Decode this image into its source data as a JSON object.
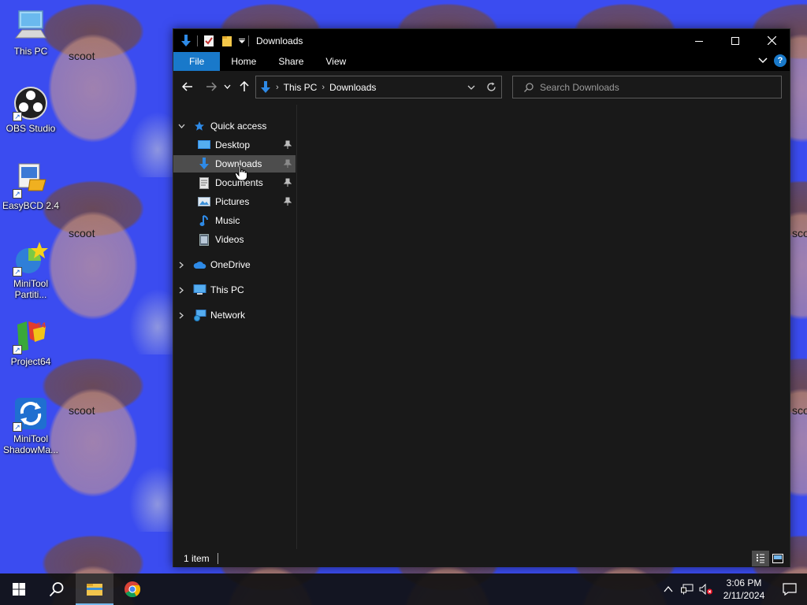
{
  "wallpaper": {
    "caption": "scoot",
    "background_color": "#3b4cf0"
  },
  "desktop": {
    "icons": [
      {
        "label": "This PC",
        "icon": "this-pc-icon"
      },
      {
        "label": "OBS Studio",
        "icon": "obs-studio-icon"
      },
      {
        "label": "EasyBCD 2.4",
        "icon": "easybcd-icon"
      },
      {
        "label": "MiniTool Partiti...",
        "icon": "minitool-partition-icon"
      },
      {
        "label": "Project64",
        "icon": "project64-icon"
      },
      {
        "label": "MiniTool ShadowMa...",
        "icon": "minitool-shadowmaker-icon"
      }
    ]
  },
  "explorer": {
    "title": "Downloads",
    "ribbon_tabs": [
      "File",
      "Home",
      "Share",
      "View"
    ],
    "breadcrumb": [
      "This PC",
      "Downloads"
    ],
    "search_placeholder": "Search Downloads",
    "nav": {
      "quick_access": "Quick access",
      "quick_items": [
        {
          "label": "Desktop",
          "pinned": true
        },
        {
          "label": "Downloads",
          "pinned": true,
          "selected": true
        },
        {
          "label": "Documents",
          "pinned": true
        },
        {
          "label": "Pictures",
          "pinned": true
        },
        {
          "label": "Music",
          "pinned": false
        },
        {
          "label": "Videos",
          "pinned": false
        }
      ],
      "onedrive": "OneDrive",
      "this_pc": "This PC",
      "network": "Network"
    },
    "status": "1 item"
  },
  "taskbar": {
    "time": "3:06 PM",
    "date": "2/11/2024"
  },
  "colors": {
    "accent": "#1979ca",
    "window_bg": "#191919",
    "selected_bg": "#4d4d4d"
  }
}
